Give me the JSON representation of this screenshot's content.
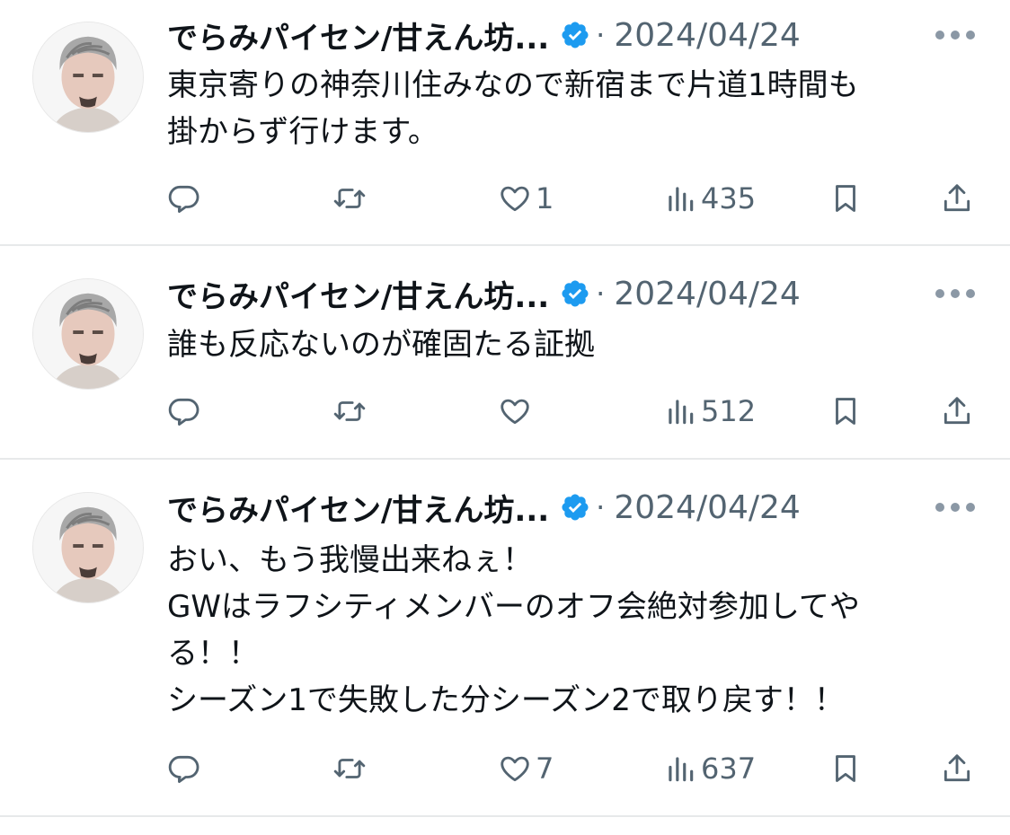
{
  "tweets": [
    {
      "display_name": "でらみパイセン/甘えん坊...",
      "separator": "·",
      "date": "2024/04/24",
      "lines": [
        "東京寄りの神奈川住みなので新宿まで片道1時間も",
        "掛からず行けます。"
      ],
      "actions": {
        "replies": "",
        "reposts": "",
        "likes": "1",
        "views": "435"
      }
    },
    {
      "display_name": "でらみパイセン/甘えん坊...",
      "separator": "·",
      "date": "2024/04/24",
      "lines": [
        "誰も反応ないのが確固たる証拠"
      ],
      "actions": {
        "replies": "",
        "reposts": "",
        "likes": "",
        "views": "512"
      }
    },
    {
      "display_name": "でらみパイセン/甘えん坊...",
      "separator": "·",
      "date": "2024/04/24",
      "lines": [
        "おい、もう我慢出来ねぇ！",
        "GWはラフシティメンバーのオフ会絶対参加してや",
        "る！！",
        "シーズン1で失敗した分シーズン2で取り戻す！！"
      ],
      "actions": {
        "replies": "",
        "reposts": "",
        "likes": "7",
        "views": "637"
      }
    }
  ],
  "icons": {
    "reply": "speech-bubble-icon",
    "repost": "repost-arrows-icon",
    "like": "heart-icon",
    "views": "bar-chart-icon",
    "bookmark": "bookmark-icon",
    "share": "share-upload-icon",
    "more": "ellipsis-icon",
    "verified": "verified-badge-icon"
  },
  "colors": {
    "text": "#0f1419",
    "secondary": "#536471",
    "verified": "#1d9bf0",
    "divider": "#e7e9ea"
  }
}
